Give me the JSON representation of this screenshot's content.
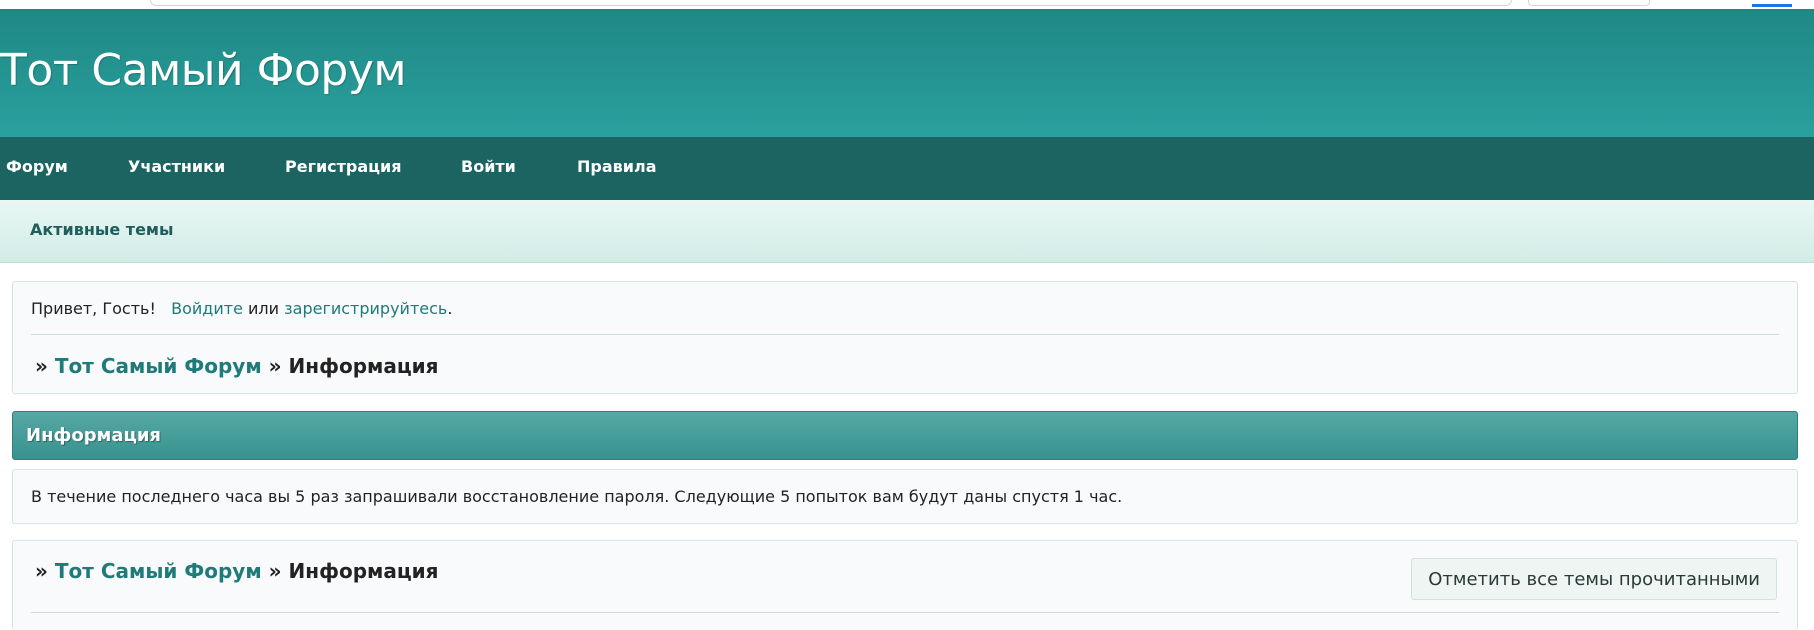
{
  "header": {
    "site_title": "Тот Самый Форум"
  },
  "nav": {
    "items": [
      {
        "label": "Форум"
      },
      {
        "label": "Участники"
      },
      {
        "label": "Регистрация"
      },
      {
        "label": "Войти"
      },
      {
        "label": "Правила"
      }
    ]
  },
  "subnav": {
    "active_topics": "Активные темы"
  },
  "welcome": {
    "greeting": "Привет, Гость!",
    "login_link": "Войдите",
    "or_text": "или",
    "register_link": "зарегистрируйтесь",
    "period": "."
  },
  "breadcrumb": {
    "separator": "»",
    "home": "Тот Самый Форум",
    "current": "Информация"
  },
  "info": {
    "title": "Информация",
    "message": "В течение последнего часа вы 5 раз запрашивали восстановление пароля. Следующие 5 попыток вам будут даны спустя 1 час."
  },
  "footer": {
    "mark_all_read": "Отметить все темы прочитанными"
  },
  "colors": {
    "header_top": "#1f8885",
    "header_bottom": "#2aa09e",
    "navbar": "#1b6462",
    "link": "#1f7a7a",
    "info_header": "#389290"
  }
}
